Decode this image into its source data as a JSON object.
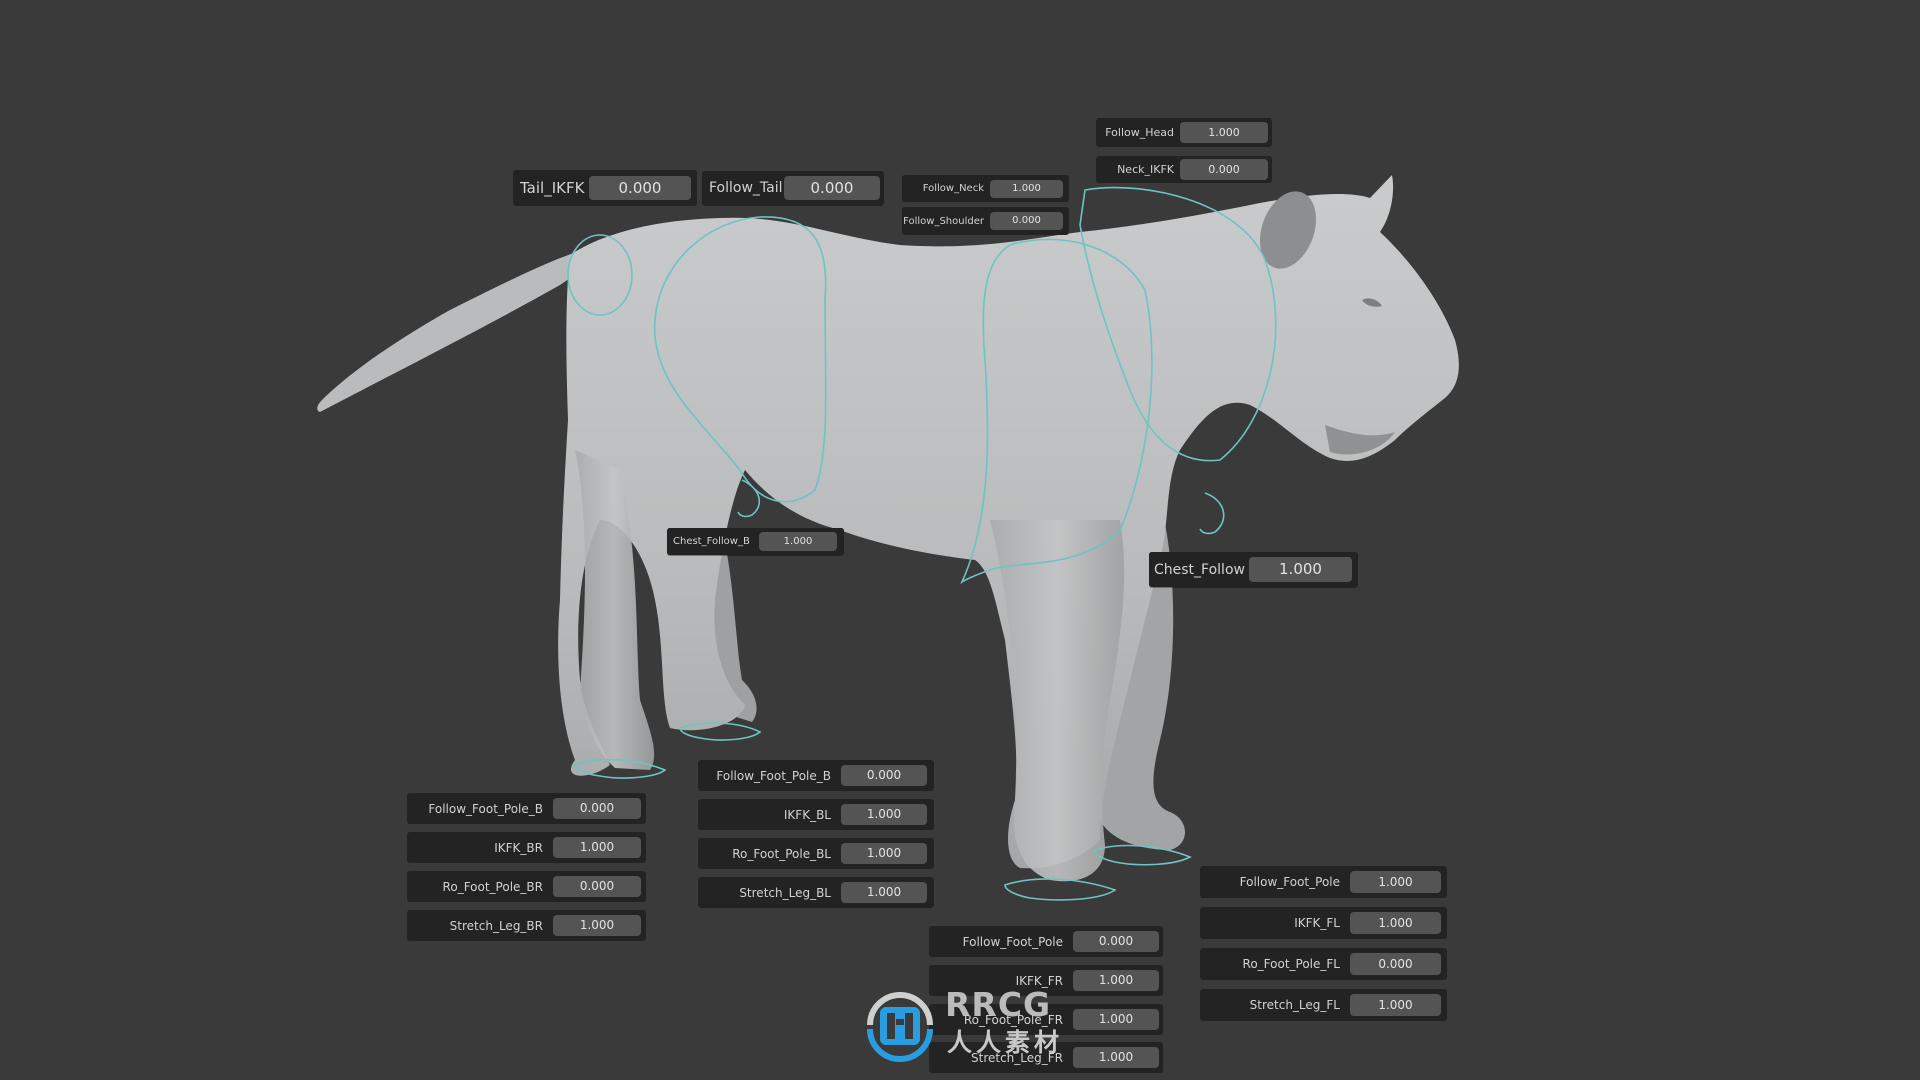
{
  "viewport": {
    "background_color": "#3a3a3a",
    "panel_color": "#232323",
    "field_color": "#545454",
    "rig_widget_color": "#6fc3c3",
    "mesh_color": "#bfc1c2"
  },
  "properties": {
    "tail_ikfk": {
      "label": "Tail_IKFK",
      "value": "0.000"
    },
    "follow_tail": {
      "label": "Follow_Tail",
      "value": "0.000"
    },
    "follow_neck": {
      "label": "Follow_Neck",
      "value": "1.000"
    },
    "follow_shoulder": {
      "label": "Follow_Shoulder",
      "value": "0.000"
    },
    "follow_head": {
      "label": "Follow_Head",
      "value": "1.000"
    },
    "neck_ikfk": {
      "label": "Neck_IKFK",
      "value": "0.000"
    },
    "chest_follow_b": {
      "label": "Chest_Follow_B",
      "value": "1.000"
    },
    "chest_follow": {
      "label": "Chest_Follow",
      "value": "1.000"
    }
  },
  "leg_panels": {
    "back_right": [
      {
        "label": "Follow_Foot_Pole_B",
        "value": "0.000"
      },
      {
        "label": "IKFK_BR",
        "value": "1.000"
      },
      {
        "label": "Ro_Foot_Pole_BR",
        "value": "0.000"
      },
      {
        "label": "Stretch_Leg_BR",
        "value": "1.000"
      }
    ],
    "back_left": [
      {
        "label": "Follow_Foot_Pole_B",
        "value": "0.000"
      },
      {
        "label": "IKFK_BL",
        "value": "1.000"
      },
      {
        "label": "Ro_Foot_Pole_BL",
        "value": "1.000"
      },
      {
        "label": "Stretch_Leg_BL",
        "value": "1.000"
      }
    ],
    "front_right": [
      {
        "label": "Follow_Foot_Pole",
        "value": "0.000"
      },
      {
        "label": "IKFK_FR",
        "value": "1.000"
      },
      {
        "label": "Ro_Foot_Pole_FR",
        "value": "1.000"
      },
      {
        "label": "Stretch_Leg_FR",
        "value": "1.000"
      }
    ],
    "front_left": [
      {
        "label": "Follow_Foot_Pole",
        "value": "1.000"
      },
      {
        "label": "IKFK_FL",
        "value": "1.000"
      },
      {
        "label": "Ro_Foot_Pole_FL",
        "value": "0.000"
      },
      {
        "label": "Stretch_Leg_FL",
        "value": "1.000"
      }
    ]
  },
  "watermark": {
    "brand": "RRCG",
    "subtitle": "人人素材",
    "icon": "rr-logo-icon",
    "icon_color": "#2a9de0"
  }
}
